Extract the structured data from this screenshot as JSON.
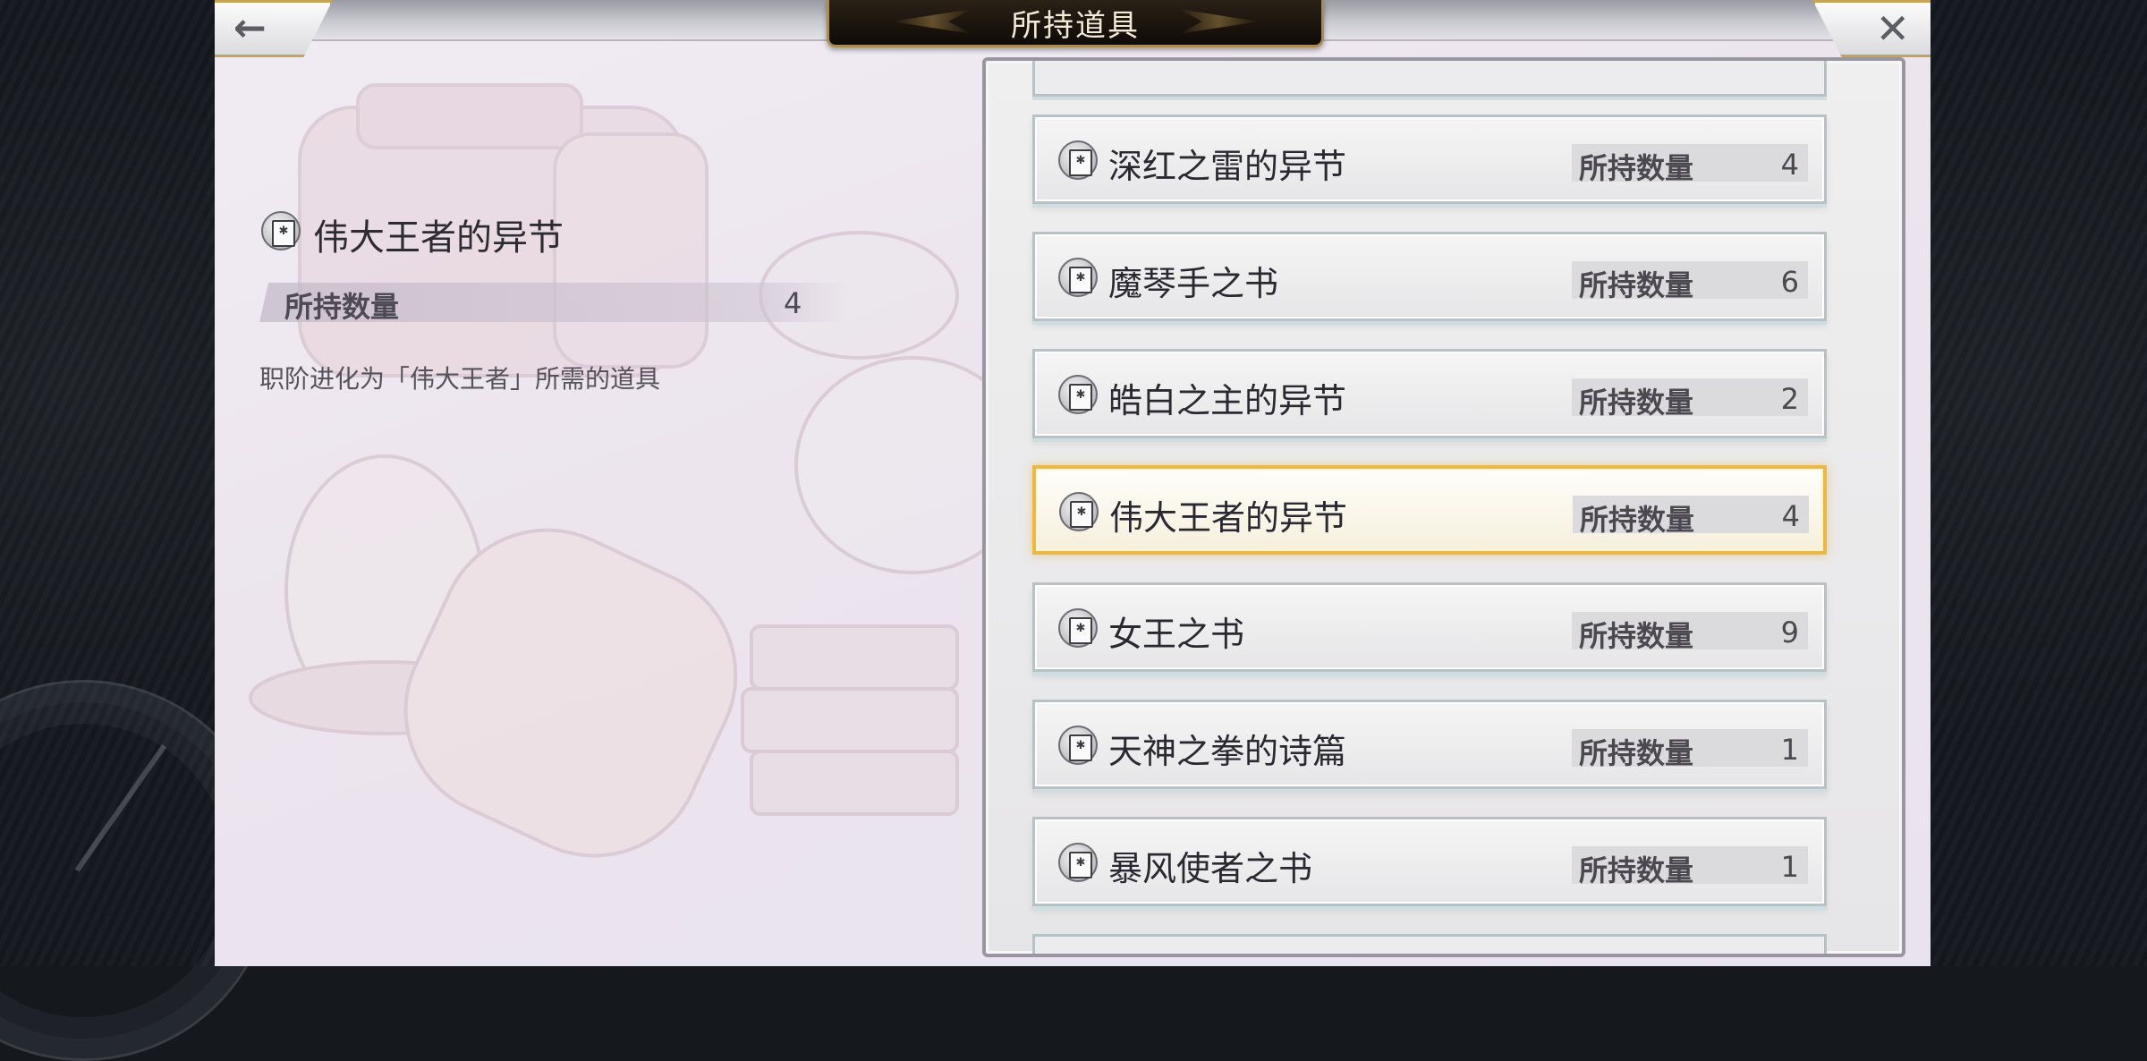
{
  "header": {
    "title": "所持道具"
  },
  "detail": {
    "name": "伟大王者的异节",
    "qty_label": "所持数量",
    "qty_value": "4",
    "description": "职阶进化为「伟大王者」所需的道具"
  },
  "list": {
    "items": [
      {
        "name": "深红之雷的异节",
        "qty_label": "所持数量",
        "qty": "4",
        "icon": "book-icon"
      },
      {
        "name": "魔琴手之书",
        "qty_label": "所持数量",
        "qty": "6",
        "icon": "book-icon"
      },
      {
        "name": "皓白之主的异节",
        "qty_label": "所持数量",
        "qty": "2",
        "icon": "book-icon"
      },
      {
        "name": "伟大王者的异节",
        "qty_label": "所持数量",
        "qty": "4",
        "icon": "book-icon",
        "selected": true
      },
      {
        "name": "女王之书",
        "qty_label": "所持数量",
        "qty": "9",
        "icon": "book-icon"
      },
      {
        "name": "天神之拳的诗篇",
        "qty_label": "所持数量",
        "qty": "1",
        "icon": "book-icon"
      },
      {
        "name": "暴风使者之书",
        "qty_label": "所持数量",
        "qty": "1",
        "icon": "book-icon"
      }
    ],
    "scroll_position": 0.82
  },
  "icons": {
    "back": "back-arrow-icon",
    "close": "close-icon",
    "item": "book-icon"
  },
  "colors": {
    "selected_border": "#e8b949",
    "title_plate": "#1c150e",
    "accent_gold": "#c6a35b"
  }
}
